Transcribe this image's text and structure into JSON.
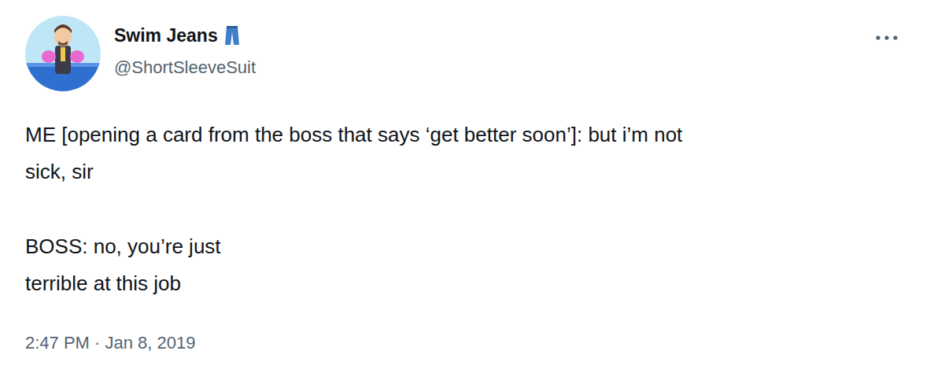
{
  "user": {
    "name": "Swim Jeans",
    "handle": "@ShortSleeveSuit"
  },
  "tweet": {
    "paragraphs": [
      [
        "ME [opening a card from the boss that says ‘get better soon’]: but i’m not",
        "sick, sir"
      ],
      [
        "BOSS: no, you’re just",
        "terrible at this job"
      ]
    ],
    "timestamp": "2:47 PM · Jan 8, 2019"
  }
}
